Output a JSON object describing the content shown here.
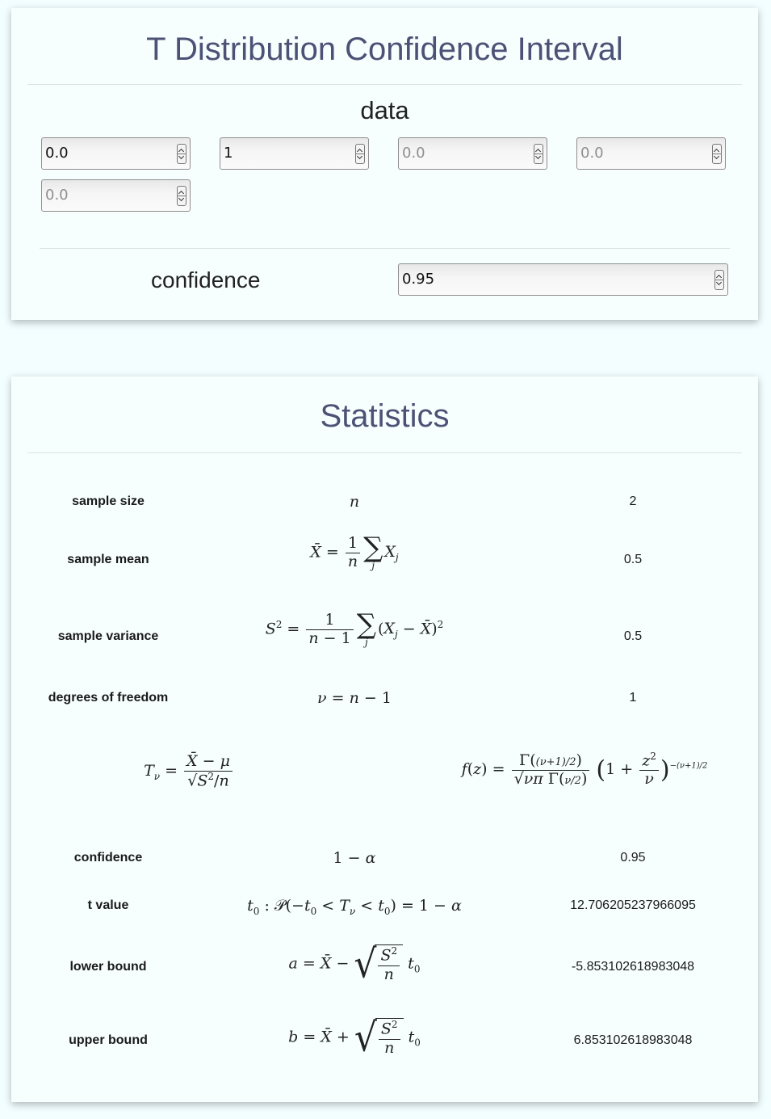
{
  "card1": {
    "title": "T Distribution Confidence Interval",
    "data_label": "data",
    "inputs": [
      {
        "value": "0.0",
        "placeholder": false
      },
      {
        "value": "1",
        "placeholder": false
      },
      {
        "value": "0.0",
        "placeholder": true
      },
      {
        "value": "0.0",
        "placeholder": true
      },
      {
        "value": "0.0",
        "placeholder": true
      }
    ],
    "confidence_label": "confidence",
    "confidence_value": "0.95"
  },
  "card2": {
    "title": "Statistics",
    "rows": [
      {
        "label": "sample size",
        "value": "2"
      },
      {
        "label": "sample mean",
        "value": "0.5"
      },
      {
        "label": "sample variance",
        "value": "0.5"
      },
      {
        "label": "degrees of freedom",
        "value": "1"
      },
      {
        "label": "confidence",
        "value": "0.95"
      },
      {
        "label": "t value",
        "value": "12.706205237966095"
      },
      {
        "label": "lower bound",
        "value": "-5.853102618983048"
      },
      {
        "label": "upper bound",
        "value": "6.853102618983048"
      }
    ]
  }
}
